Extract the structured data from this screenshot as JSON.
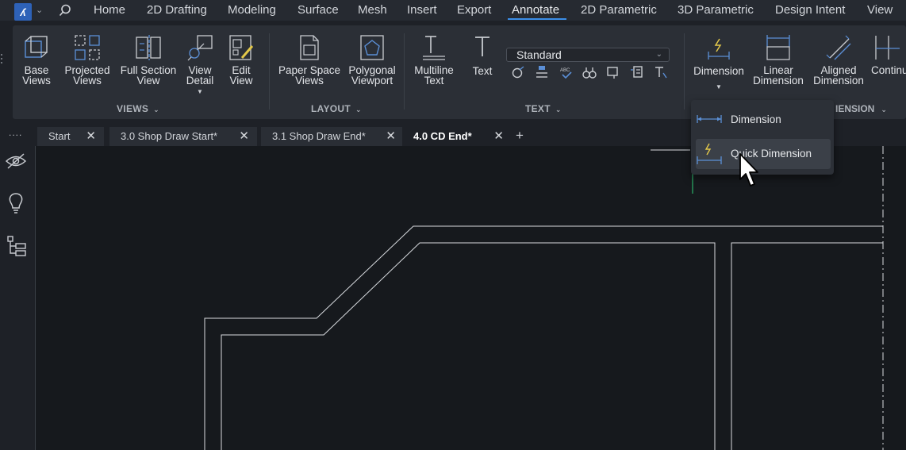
{
  "menu": {
    "items": [
      "Home",
      "2D Drafting",
      "Modeling",
      "Surface",
      "Mesh",
      "Insert",
      "Export",
      "Annotate",
      "2D Parametric",
      "3D Parametric",
      "Design Intent",
      "View"
    ],
    "active": "Annotate"
  },
  "ribbon": {
    "views": {
      "label": "VIEWS",
      "tools": [
        "Base\nViews",
        "Projected\nViews",
        "Full Section\nView",
        "View\nDetail",
        "Edit\nView"
      ]
    },
    "layout": {
      "label": "LAYOUT",
      "tools": [
        "Paper Space\nViews",
        "Polygonal\nViewport"
      ]
    },
    "text": {
      "label": "TEXT",
      "tools": [
        "Multiline\nText",
        "Text"
      ],
      "style_value": "Standard"
    },
    "dimension": {
      "label_tail": "IENSION",
      "tools": [
        "Dimension",
        "Linear\nDimension",
        "Aligned\nDimension",
        "Continu"
      ]
    }
  },
  "dropdown": {
    "items": [
      "Dimension",
      "Quick Dimension"
    ],
    "hovered": "Quick Dimension"
  },
  "tabs": [
    {
      "label": "Start",
      "active": false
    },
    {
      "label": "3.0 Shop Draw Start*",
      "active": false
    },
    {
      "label": "3.1 Shop Draw End*",
      "active": false
    },
    {
      "label": "4.0 CD End*",
      "active": true
    }
  ],
  "tabs_overflow": "....",
  "colors": {
    "accent": "#3b8ee8",
    "icon_blue": "#5b8fd6",
    "icon_yellow": "#e3c84a",
    "drawing_line": "#d9dce0"
  }
}
